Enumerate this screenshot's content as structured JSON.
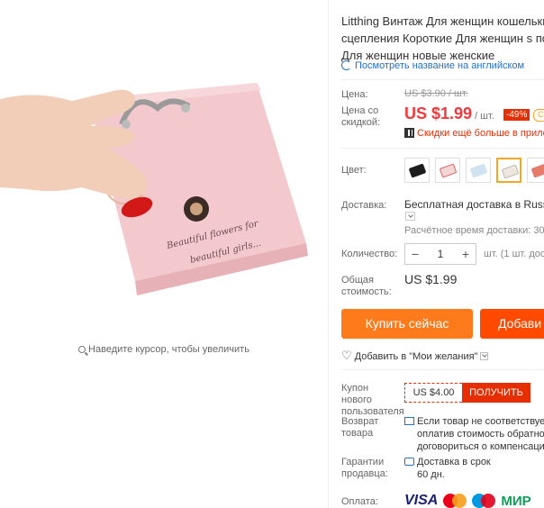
{
  "gallery": {
    "zoom_hint": "Наведите курсор, чтобы увеличить"
  },
  "product": {
    "title_lines": [
      "Litthing Винтаж Для женщин кошельки",
      "сцепления Короткие Для женщин s пор",
      "Для женщин новые женские"
    ],
    "english_link": "Посмотреть название на английском"
  },
  "price": {
    "label": "Цена:",
    "old": "US $3.90 / шт.",
    "discount_label": "Цена со скидкой:",
    "new": "US $1.99",
    "per_unit": "/ шт.",
    "discount": "-49%",
    "coupon_tag": "C",
    "app_promo": "Скидки ещё больше в прилож"
  },
  "color": {
    "label": "Цвет:",
    "swatches": [
      {
        "name": "black",
        "color": "#1c1c1c"
      },
      {
        "name": "white-red",
        "color": "#f2d6d3"
      },
      {
        "name": "light-blue",
        "color": "#cfe3f0"
      },
      {
        "name": "white",
        "color": "#efe6e0"
      },
      {
        "name": "pink",
        "color": "#e9b9bd",
        "selected": true
      },
      {
        "name": "red",
        "color": "#e67b6a"
      }
    ]
  },
  "shipping": {
    "label": "Доставка:",
    "text": "Бесплатная доставка в Russian",
    "time": "Расчётное время доставки: 30-50"
  },
  "quantity": {
    "label": "Количество:",
    "minus": "−",
    "value": "1",
    "plus": "+",
    "note": "шт. (1 шт. доступ"
  },
  "total": {
    "label": "Общая стоимость:",
    "value": "US $1.99"
  },
  "actions": {
    "buy_now": "Купить сейчас",
    "add_cart": "Добави",
    "wishlist": "Добавить в \"Мои желания\""
  },
  "coupon": {
    "label": "Купон нового пользователя",
    "amount": "US $4.00",
    "get": "ПОЛУЧИТЬ"
  },
  "returns": {
    "label": "Возврат товара",
    "lines": [
      "Если товар не соответствует о",
      "оплатив стоимость обратной",
      "договориться о компенсации"
    ]
  },
  "guarantee": {
    "label": "Гарантии продавца:",
    "line1": "Доставка в срок",
    "line2": "60 дн."
  },
  "payment": {
    "label": "Оплата:",
    "visa": "VISA",
    "mir": "МИР"
  }
}
